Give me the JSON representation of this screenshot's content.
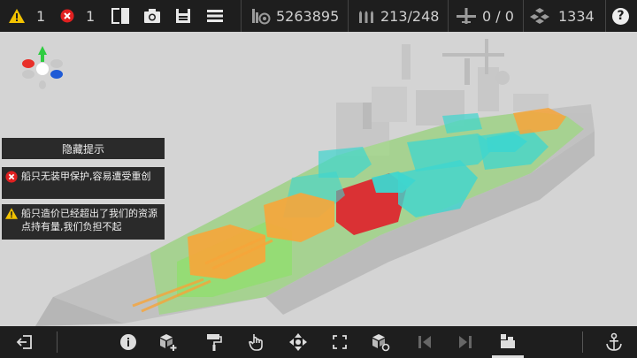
{
  "topbar": {
    "warnings_count": "1",
    "errors_count": "1",
    "funds": "5263895",
    "ammo": "213/248",
    "aircraft": "0 / 0",
    "resources": "1334",
    "help_label": "?"
  },
  "hints": {
    "hide_label": "隐藏提示",
    "items": [
      {
        "type": "error",
        "text": "船只无装甲保护,容易遭受重创"
      },
      {
        "type": "warning",
        "text": "船只造价已经超出了我们的资源点持有量,我们负担不起"
      }
    ]
  },
  "colors": {
    "bar_bg": "#1e1e1e",
    "warning": "#f2c200",
    "error": "#e02020",
    "module_orange": "#f7a53a",
    "module_cyan": "#3ed6cf",
    "module_green": "#8fe06a",
    "module_red": "#e01f2a",
    "hull_gray": "#b8b8b8",
    "gizmo_green": "#2ecc40",
    "gizmo_red": "#e8302a",
    "gizmo_blue": "#1f5bd6"
  },
  "icons": {
    "top": [
      "warning-icon",
      "error-icon",
      "split-view-icon",
      "camera-icon",
      "save-icon",
      "menu-icon",
      "coins-icon",
      "ammo-icon",
      "aircraft-icon",
      "resources-icon",
      "help-icon"
    ],
    "bottom": [
      "exit-icon",
      "info-icon",
      "add-block-icon",
      "paint-roller-icon",
      "hand-icon",
      "move-icon",
      "rotate-icon",
      "block-settings-icon",
      "prev-icon",
      "next-icon",
      "ship-parts-icon",
      "anchor-icon"
    ]
  }
}
